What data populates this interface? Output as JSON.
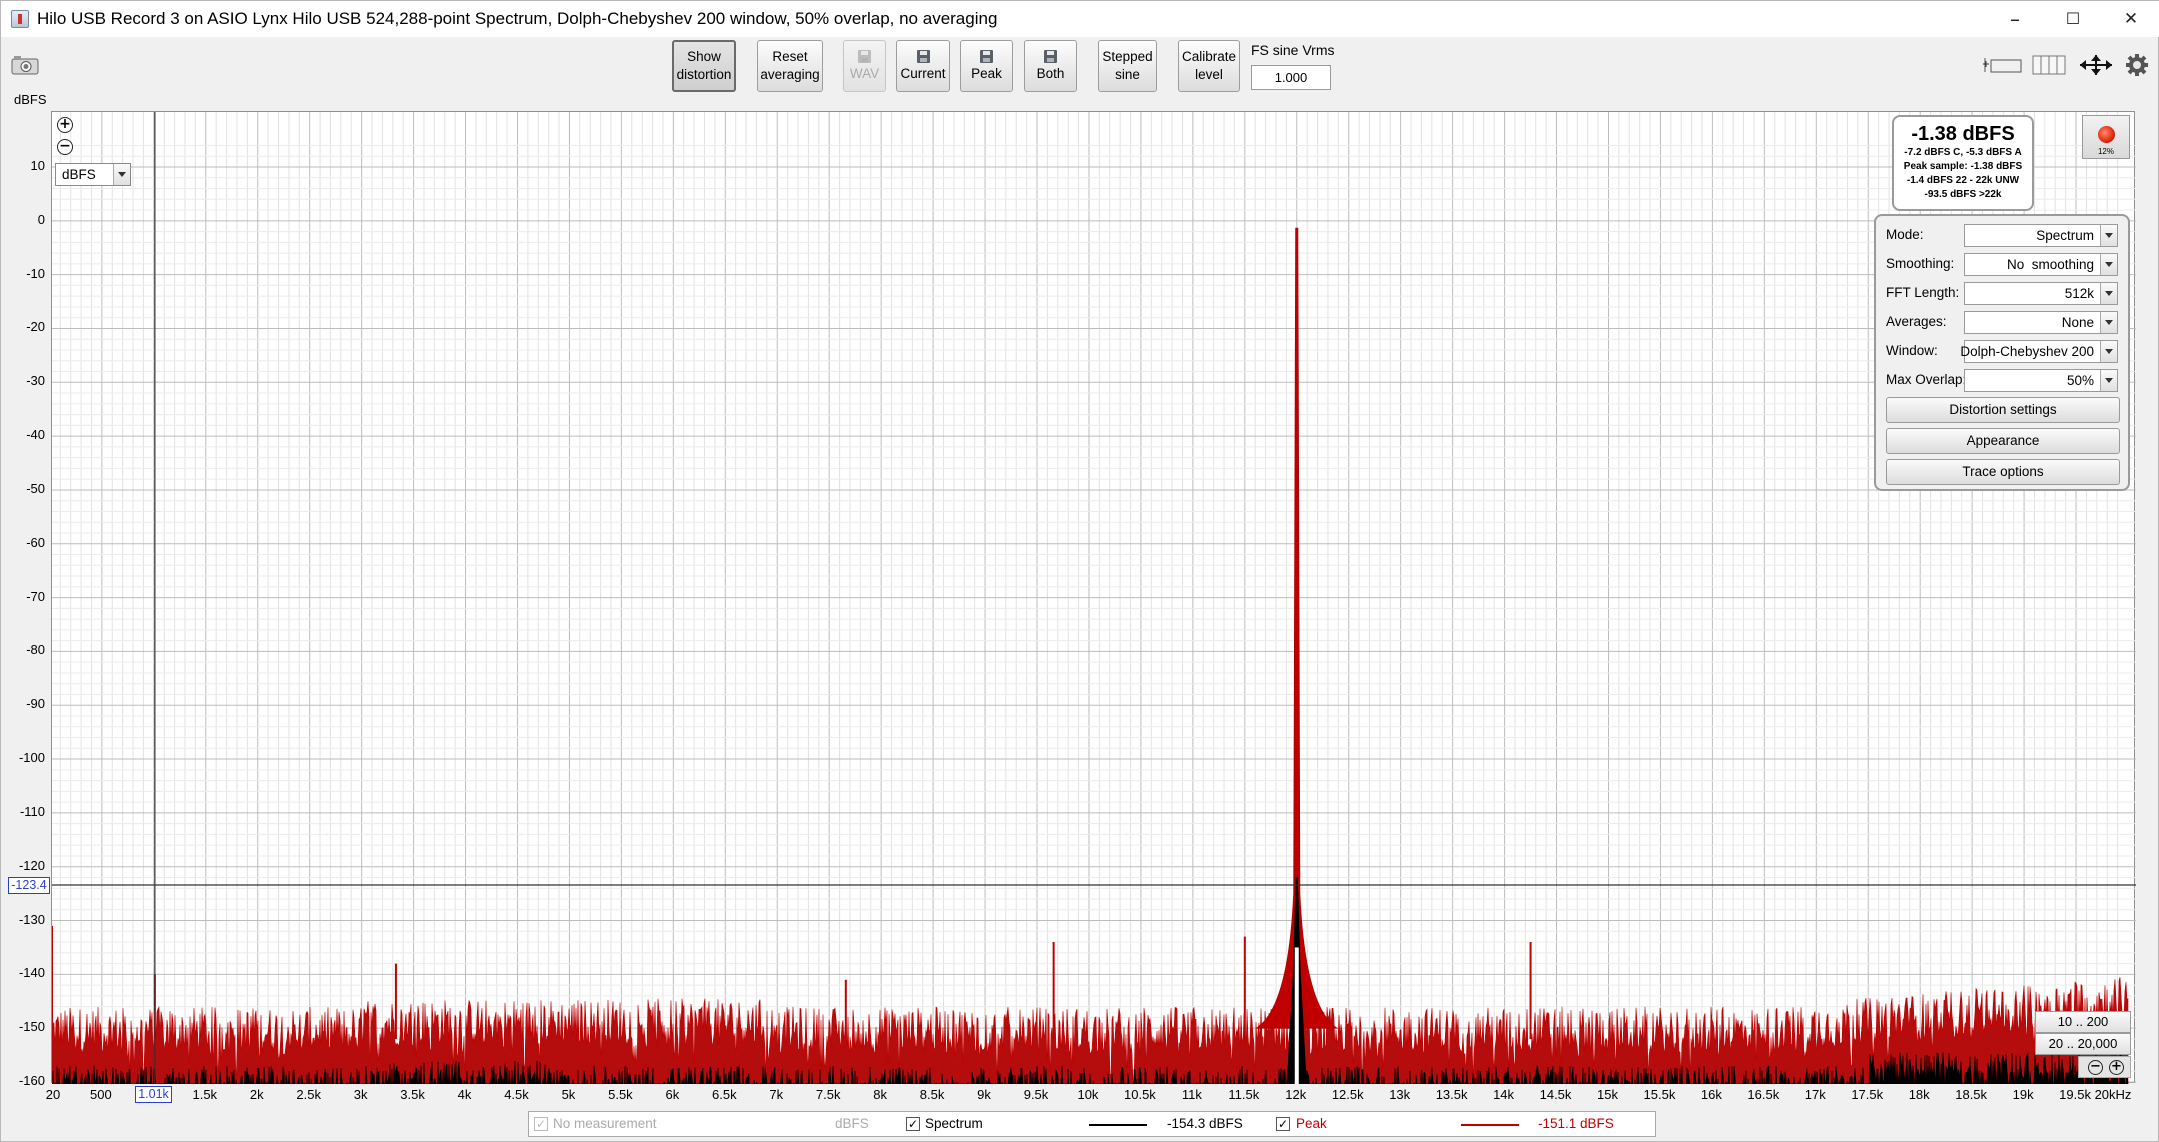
{
  "window": {
    "title": "Hilo USB Record 3 on ASIO Lynx Hilo USB 524,288-point Spectrum, Dolph-Chebyshev 200 window, 50% overlap, no averaging",
    "minimize": "–",
    "maximize": "☐",
    "close": "✕"
  },
  "toolbar": {
    "show_distortion": [
      "Show",
      "distortion"
    ],
    "reset_averaging": [
      "Reset",
      "averaging"
    ],
    "wav": "WAV",
    "current": "Current",
    "peak": "Peak",
    "both": "Both",
    "stepped_sine": [
      "Stepped",
      "sine"
    ],
    "calibrate_level": [
      "Calibrate",
      "level"
    ],
    "fs_label": "FS sine Vrms",
    "fs_value": "1.000"
  },
  "plot": {
    "y_unit_label": "dBFS",
    "unit_select": "dBFS",
    "cursor_y": "-123.4",
    "cursor_x": "1.01k",
    "y_ticks": [
      "10",
      "0",
      "-10",
      "-20",
      "-30",
      "-40",
      "-50",
      "-60",
      "-70",
      "-80",
      "-90",
      "-100",
      "-110",
      "-120",
      "-130",
      "-140",
      "-150",
      "-160"
    ],
    "x_ticks": [
      "20",
      "500",
      "1.5k",
      "2k",
      "2.5k",
      "3k",
      "3.5k",
      "4k",
      "4.5k",
      "5k",
      "5.5k",
      "6k",
      "6.5k",
      "7k",
      "7.5k",
      "8k",
      "8.5k",
      "9k",
      "9.5k",
      "10k",
      "10.5k",
      "11k",
      "11.5k",
      "12k",
      "12.5k",
      "13k",
      "13.5k",
      "14k",
      "14.5k",
      "15k",
      "15.5k",
      "16k",
      "16.5k",
      "17k",
      "17.5k",
      "18k",
      "18.5k",
      "19k",
      "19.5k",
      "20kHz"
    ]
  },
  "level": {
    "main": "-1.38 dBFS",
    "lines": [
      "-7.2 dBFS C, -5.3 dBFS A",
      "Peak sample: -1.38 dBFS",
      "-1.4 dBFS 22 - 22k UNW",
      "-93.5 dBFS >22k"
    ],
    "record_pct": "12%"
  },
  "settings": {
    "mode_label": "Mode:",
    "mode": "Spectrum",
    "smoothing_label": "Smoothing:",
    "smoothing": "No  smoothing",
    "fft_label": "FFT Length:",
    "fft": "512k",
    "averages_label": "Averages:",
    "averages": "None",
    "window_label": "Window:",
    "window": "Dolph-Chebyshev 200",
    "overlap_label": "Max Overlap:",
    "overlap": "50%",
    "distortion_settings": "Distortion settings",
    "appearance": "Appearance",
    "trace_options": "Trace options"
  },
  "ranges": {
    "r1": "10 .. 200",
    "r2": "20 .. 20,000"
  },
  "legend": {
    "no_measurement": "No measurement",
    "no_measurement_unit": "dBFS",
    "spectrum": "Spectrum",
    "spectrum_value": "-154.3 dBFS",
    "peak": "Peak",
    "peak_value": "-151.1 dBFS",
    "spectrum_color": "#000000",
    "peak_color": "#c00000"
  },
  "chart_data": {
    "type": "line",
    "ylabel": "dBFS",
    "xlabel": "",
    "xlim": [
      20,
      20000
    ],
    "ylim": [
      -160,
      15
    ],
    "x_scale": "linear",
    "grid": true,
    "series": [
      {
        "name": "Spectrum",
        "color": "#000000",
        "noise_floor_dbfs": -158,
        "peak_hz": 12000,
        "peak_dbfs": -1.38
      },
      {
        "name": "Peak",
        "color": "#c00000",
        "noise_floor_dbfs": -151,
        "peak_hz": 12000,
        "peak_dbfs": -1.38,
        "spurs": [
          {
            "hz": 20,
            "dbfs": -131
          },
          {
            "hz": 1010,
            "dbfs": -140
          },
          {
            "hz": 3330,
            "dbfs": -138
          },
          {
            "hz": 7660,
            "dbfs": -141
          },
          {
            "hz": 9660,
            "dbfs": -134
          },
          {
            "hz": 11500,
            "dbfs": -133
          },
          {
            "hz": 14250,
            "dbfs": -134
          }
        ]
      }
    ]
  }
}
